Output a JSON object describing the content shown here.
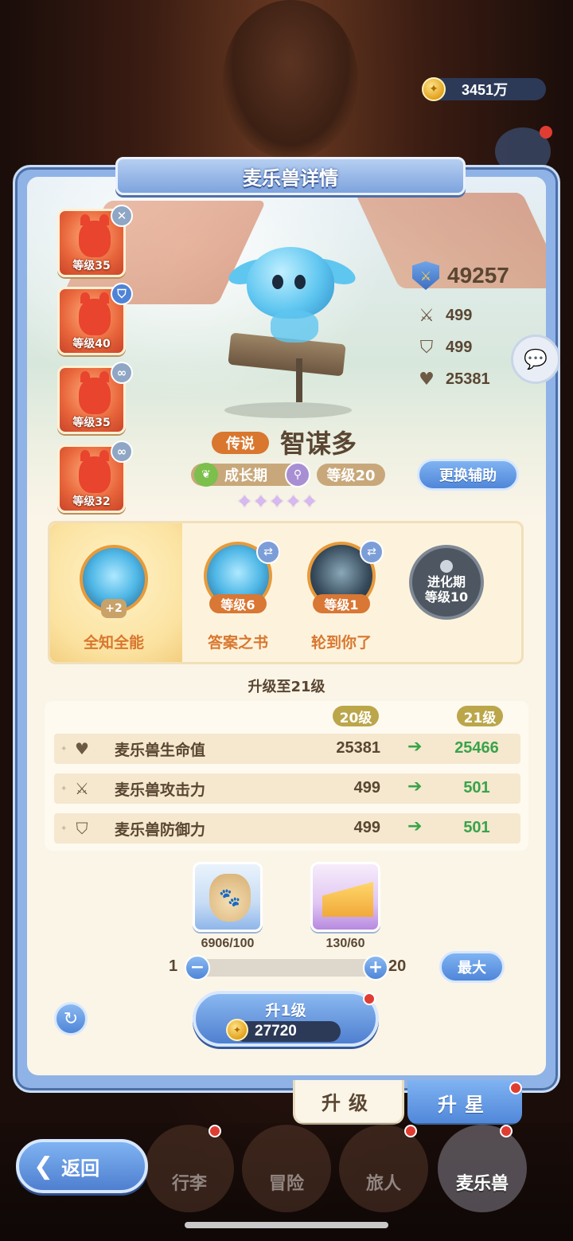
{
  "currency": {
    "gold": "3451万",
    "icon": "gold-coin-icon"
  },
  "panel": {
    "title": "麦乐兽详情"
  },
  "team": [
    {
      "level": "等级35",
      "badge_icon": "close-icon"
    },
    {
      "level": "等级40",
      "badge_icon": "shield-icon"
    },
    {
      "level": "等级35",
      "badge_icon": "link-icon"
    },
    {
      "level": "等级32",
      "badge_icon": "link-icon"
    }
  ],
  "pet": {
    "rarity": "传说",
    "name": "智谋多",
    "stage": "成长期",
    "level": "等级20",
    "stars": 5,
    "swap_button": "更换辅助"
  },
  "stats": {
    "power": "49257",
    "attack": "499",
    "defense": "499",
    "hp": "25381"
  },
  "skills": {
    "main": {
      "name": "全知全能",
      "badge": "+2"
    },
    "slot1": {
      "name": "答案之书",
      "level": "等级6"
    },
    "slot2": {
      "name": "轮到你了",
      "level": "等级1"
    },
    "locked": {
      "line1": "进化期",
      "line2": "等级10"
    }
  },
  "upgrade": {
    "title": "升级至21级",
    "from_level": "20级",
    "to_level": "21级",
    "rows": [
      {
        "label": "麦乐兽生命值",
        "from": "25381",
        "to": "25466",
        "icon": "heart-icon"
      },
      {
        "label": "麦乐兽攻击力",
        "from": "499",
        "to": "501",
        "icon": "crossed-swords-icon"
      },
      {
        "label": "麦乐兽防御力",
        "from": "499",
        "to": "501",
        "icon": "shield-icon"
      }
    ],
    "arrow": "➔"
  },
  "materials": [
    {
      "name": "pet-food-bag",
      "count": "6906/100"
    },
    {
      "name": "cheese",
      "count": "130/60"
    }
  ],
  "slider": {
    "min": "1",
    "max": "20",
    "max_button": "最大",
    "value_fraction": 0.0
  },
  "levelup": {
    "label": "升1级",
    "cost": "27720"
  },
  "tabs": {
    "upgrade": "升级",
    "star": "升星"
  },
  "nav": {
    "back": "返回",
    "items": [
      "行李",
      "冒险",
      "旅人",
      "麦乐兽"
    ]
  }
}
